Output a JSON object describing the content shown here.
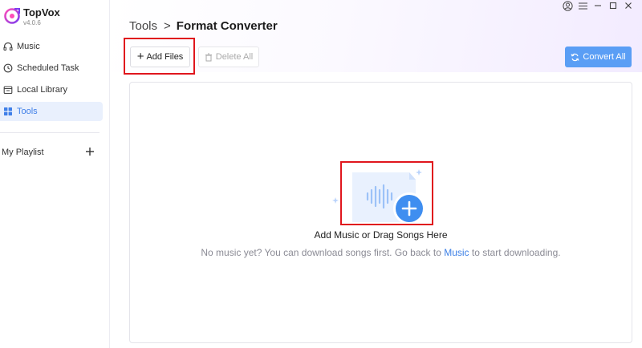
{
  "app": {
    "name": "TopVox",
    "version": "v4.0.6"
  },
  "sidebar": {
    "items": [
      {
        "label": "Music",
        "icon": "headphones-icon"
      },
      {
        "label": "Scheduled Task",
        "icon": "clock-icon"
      },
      {
        "label": "Local Library",
        "icon": "library-icon"
      },
      {
        "label": "Tools",
        "icon": "tools-grid-icon",
        "active": true
      }
    ],
    "playlist_label": "My Playlist"
  },
  "header": {
    "breadcrumb_parent": "Tools",
    "breadcrumb_separator": ">",
    "breadcrumb_current": "Format Converter"
  },
  "toolbar": {
    "add_files_label": "Add Files",
    "delete_all_label": "Delete All",
    "convert_all_label": "Convert All"
  },
  "dropzone": {
    "title": "Add Music or Drag Songs Here",
    "hint_before": "No music yet? You can download songs first. Go back to ",
    "hint_link": "Music",
    "hint_after": " to start downloading."
  },
  "colors": {
    "accent": "#5a9ef5",
    "active_nav_bg": "#e9f0fd",
    "highlight": "#e0161d",
    "link": "#3d80e6"
  }
}
